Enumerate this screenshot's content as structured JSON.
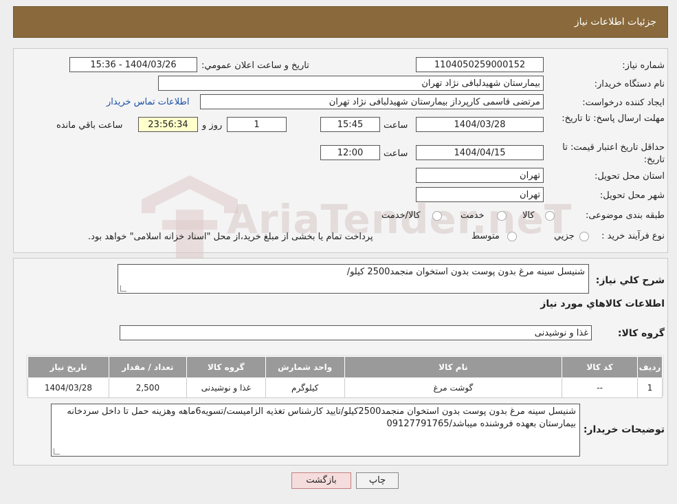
{
  "header": {
    "title": "جزئيات اطلاعات نياز"
  },
  "watermark": {
    "text": "AriaTender.neT"
  },
  "form": {
    "need_number_label": "شماره نياز:",
    "need_number": "1104050259000152",
    "announce_label": "تاريخ و ساعت اعلان عمومي:",
    "announce_value": "1404/03/26 - 15:36",
    "buyer_label": "نام دستگاه خريدار:",
    "buyer_value": "بیمارستان شهیدلبافی نژاد تهران",
    "creator_label": "ايجاد کننده درخواست:",
    "creator_value": "مرتضی  قاسمی کارپرداز بیمارستان شهیدلبافی نژاد تهران",
    "contact_link": "اطلاعات تماس خريدار",
    "deadline_label": "مهلت ارسال پاسخ: تا تاريخ:",
    "deadline_date": "1404/03/28",
    "time_label": "ساعت",
    "deadline_time": "15:45",
    "days_value": "1",
    "days_label": "روز و",
    "remaining_time": "23:56:34",
    "remaining_label": "ساعت باقي مانده",
    "validity_label": "حداقل تاريخ اعتبار قيمت: تا تاريخ:",
    "validity_date": "1404/04/15",
    "validity_time": "12:00",
    "province_label": "استان محل تحويل:",
    "province_value": "تهران",
    "city_label": "شهر محل تحويل:",
    "city_value": "تهران",
    "category_label": "طبقه بندی موضوعی:",
    "category_options": [
      "کالا",
      "خدمت",
      "کالا/خدمت"
    ],
    "process_label": "نوع فرآيند خريد :",
    "process_options": [
      "جزيي",
      "متوسط"
    ],
    "process_note": "پرداخت تمام يا بخشی از مبلغ خريد،از محل \"اسناد خزانه اسلامی\" خواهد بود."
  },
  "details": {
    "summary_label": "شرح کلي نياز:",
    "summary_value": "شنیسل سینه مرغ بدون پوست بدون استخوان منجمد2500 کیلو/",
    "goods_info_title": "اطلاعات کالاهاي مورد نياز",
    "group_label": "گروه کالا:",
    "group_value": "غذا و نوشیدنی",
    "table": {
      "headers": [
        "رديف",
        "کد کالا",
        "نام کالا",
        "واحد شمارش",
        "گروه کالا",
        "تعداد / مقدار",
        "تاريخ نياز"
      ],
      "rows": [
        [
          "1",
          "--",
          "گوشت مرغ",
          "کیلوگرم",
          "غذا و نوشیدنی",
          "2,500",
          "1404/03/28"
        ]
      ]
    },
    "buyer_notes_label": "توضيحات خريدار:",
    "buyer_notes": "شنیسل سینه مرغ بدون پوست بدون استخوان منجمد2500کیلو/تایید کارشناس تغذیه الزامیست/تسویه6ماهه وهزینه حمل تا داخل سردخانه بیمارستان بعهده فروشنده میباشد/09127791765"
  },
  "buttons": {
    "print": "چاپ",
    "back": "بازگشت"
  }
}
